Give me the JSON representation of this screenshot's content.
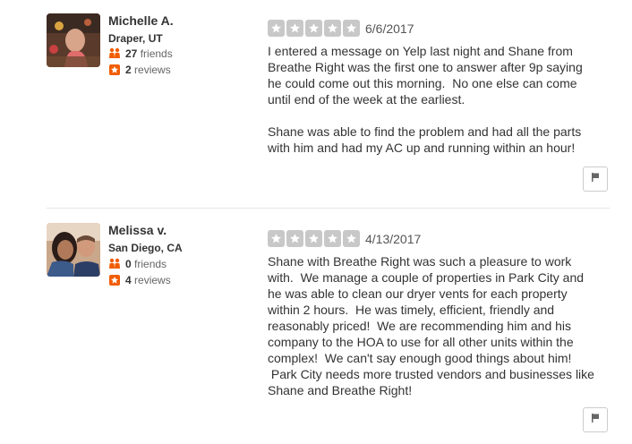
{
  "colors": {
    "star_empty": "#c8c8c8",
    "reviews_icon": "#f15c00",
    "friends_icon": "#f15c00"
  },
  "reviews": [
    {
      "user": {
        "name": "Michelle A.",
        "location": "Draper, UT",
        "friends_count": "27",
        "friends_label": "friends",
        "reviews_count": "2",
        "reviews_label": "reviews"
      },
      "rating": 0,
      "date": "6/6/2017",
      "text": "I entered a message on Yelp last night and Shane from\nBreathe Right was the first one to answer after 9p saying\nhe could come out this morning.  No one else can come\nuntil end of the week at the earliest.\n\nShane was able to find the problem and had all the parts\nwith him and had my AC up and running within an hour!"
    },
    {
      "user": {
        "name": "Melissa v.",
        "location": "San Diego, CA",
        "friends_count": "0",
        "friends_label": "friends",
        "reviews_count": "4",
        "reviews_label": "reviews"
      },
      "rating": 0,
      "date": "4/13/2017",
      "text": "Shane with Breathe Right was such a pleasure to work\nwith.  We manage a couple of properties in Park City and\nhe was able to clean our dryer vents for each property\nwithin 2 hours.  He was timely, efficient, friendly and\nreasonably priced!  We are recommending him and his\ncompany to the HOA to use for all other units within the\ncomplex!  We can't say enough good things about him!\n Park City needs more trusted vendors and businesses like\nShane and Breathe Right!"
    }
  ]
}
